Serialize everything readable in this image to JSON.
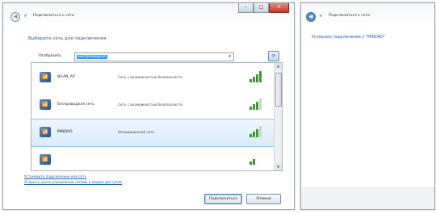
{
  "window1": {
    "title": "Подключиться к сети",
    "caption": {
      "minimize": "–",
      "maximize": "□",
      "close": "✕"
    },
    "heading": "Выберите сеть для подключения",
    "filter": {
      "label": "Отобразить",
      "value": "Беспроводная"
    },
    "networks": [
      {
        "name": "WLAN_AP",
        "description": "Сеть с возможностью безопасности",
        "signal": 4
      },
      {
        "name": "Беспроводная сеть",
        "description": "Сеть с возможностью безопасности",
        "signal": 3
      },
      {
        "name": "MINDAO",
        "description": "Незащищенная сеть",
        "signal": 3,
        "selected": true
      },
      {
        "name": "",
        "description": "",
        "signal": 2
      }
    ],
    "links": [
      "Установить подключение или сеть",
      "Открыть центр управления сетями и общим доступом"
    ],
    "buttons": {
      "connect": "Подключиться",
      "cancel": "Отмена"
    }
  },
  "window2": {
    "title": "Подключиться к сети",
    "message": "Успешное подключение к \"MINDAO\""
  },
  "colors": {
    "accent": "#1e5bb4",
    "signal": "#3c9b2e",
    "selection": "#d9ebfb",
    "close": "#c0392b"
  }
}
